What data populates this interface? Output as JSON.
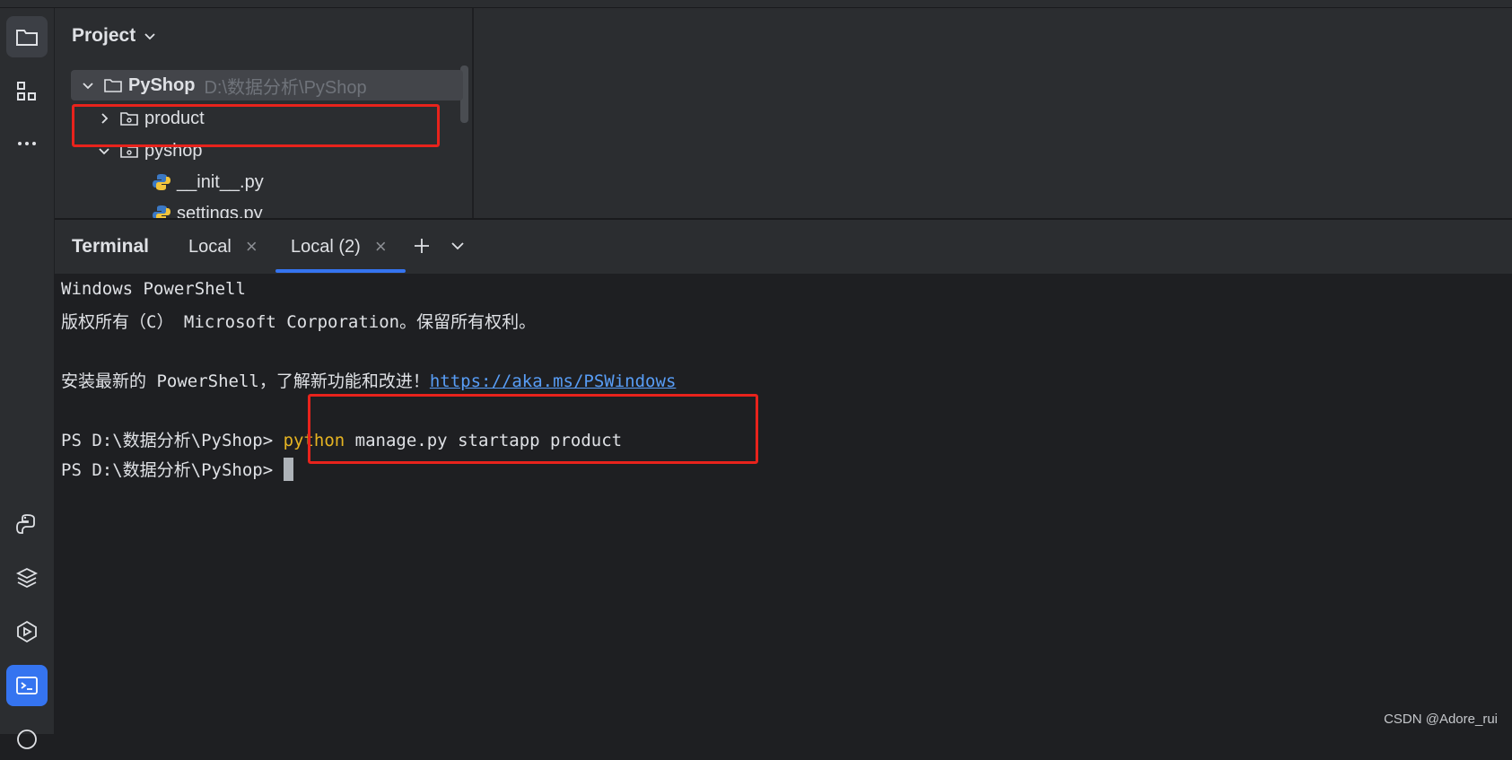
{
  "project_panel": {
    "title": "Project",
    "tree": [
      {
        "label": "PyShop",
        "path": "D:\\数据分析\\PyShop"
      },
      {
        "label": "product"
      },
      {
        "label": "pyshop"
      },
      {
        "label": "__init__.py"
      },
      {
        "label": "settings.py"
      }
    ]
  },
  "terminal": {
    "title": "Terminal",
    "tabs": [
      {
        "label": "Local"
      },
      {
        "label": "Local (2)"
      }
    ],
    "lines": {
      "l1": "Windows PowerShell",
      "l2": "版权所有（C） Microsoft Corporation。保留所有权利。",
      "l3_text": "安装最新的 PowerShell，了解新功能和改进！",
      "l3_link": "https://aka.ms/PSWindows",
      "prompt": "PS D:\\数据分析\\PyShop> ",
      "cmd_keyword": "python",
      "cmd_rest": " manage.py startapp product"
    }
  },
  "watermark": "CSDN @Adore_rui",
  "colors": {
    "accent": "#3574f0",
    "highlight_box": "#e8231c",
    "keyword": "#e6b422",
    "link": "#589df6"
  },
  "icons": [
    "folder-icon",
    "structure-icon",
    "more-icon",
    "python-console-icon",
    "layers-icon",
    "services-icon",
    "terminal-icon",
    "add-icon",
    "chevron-down-icon",
    "close-icon"
  ]
}
